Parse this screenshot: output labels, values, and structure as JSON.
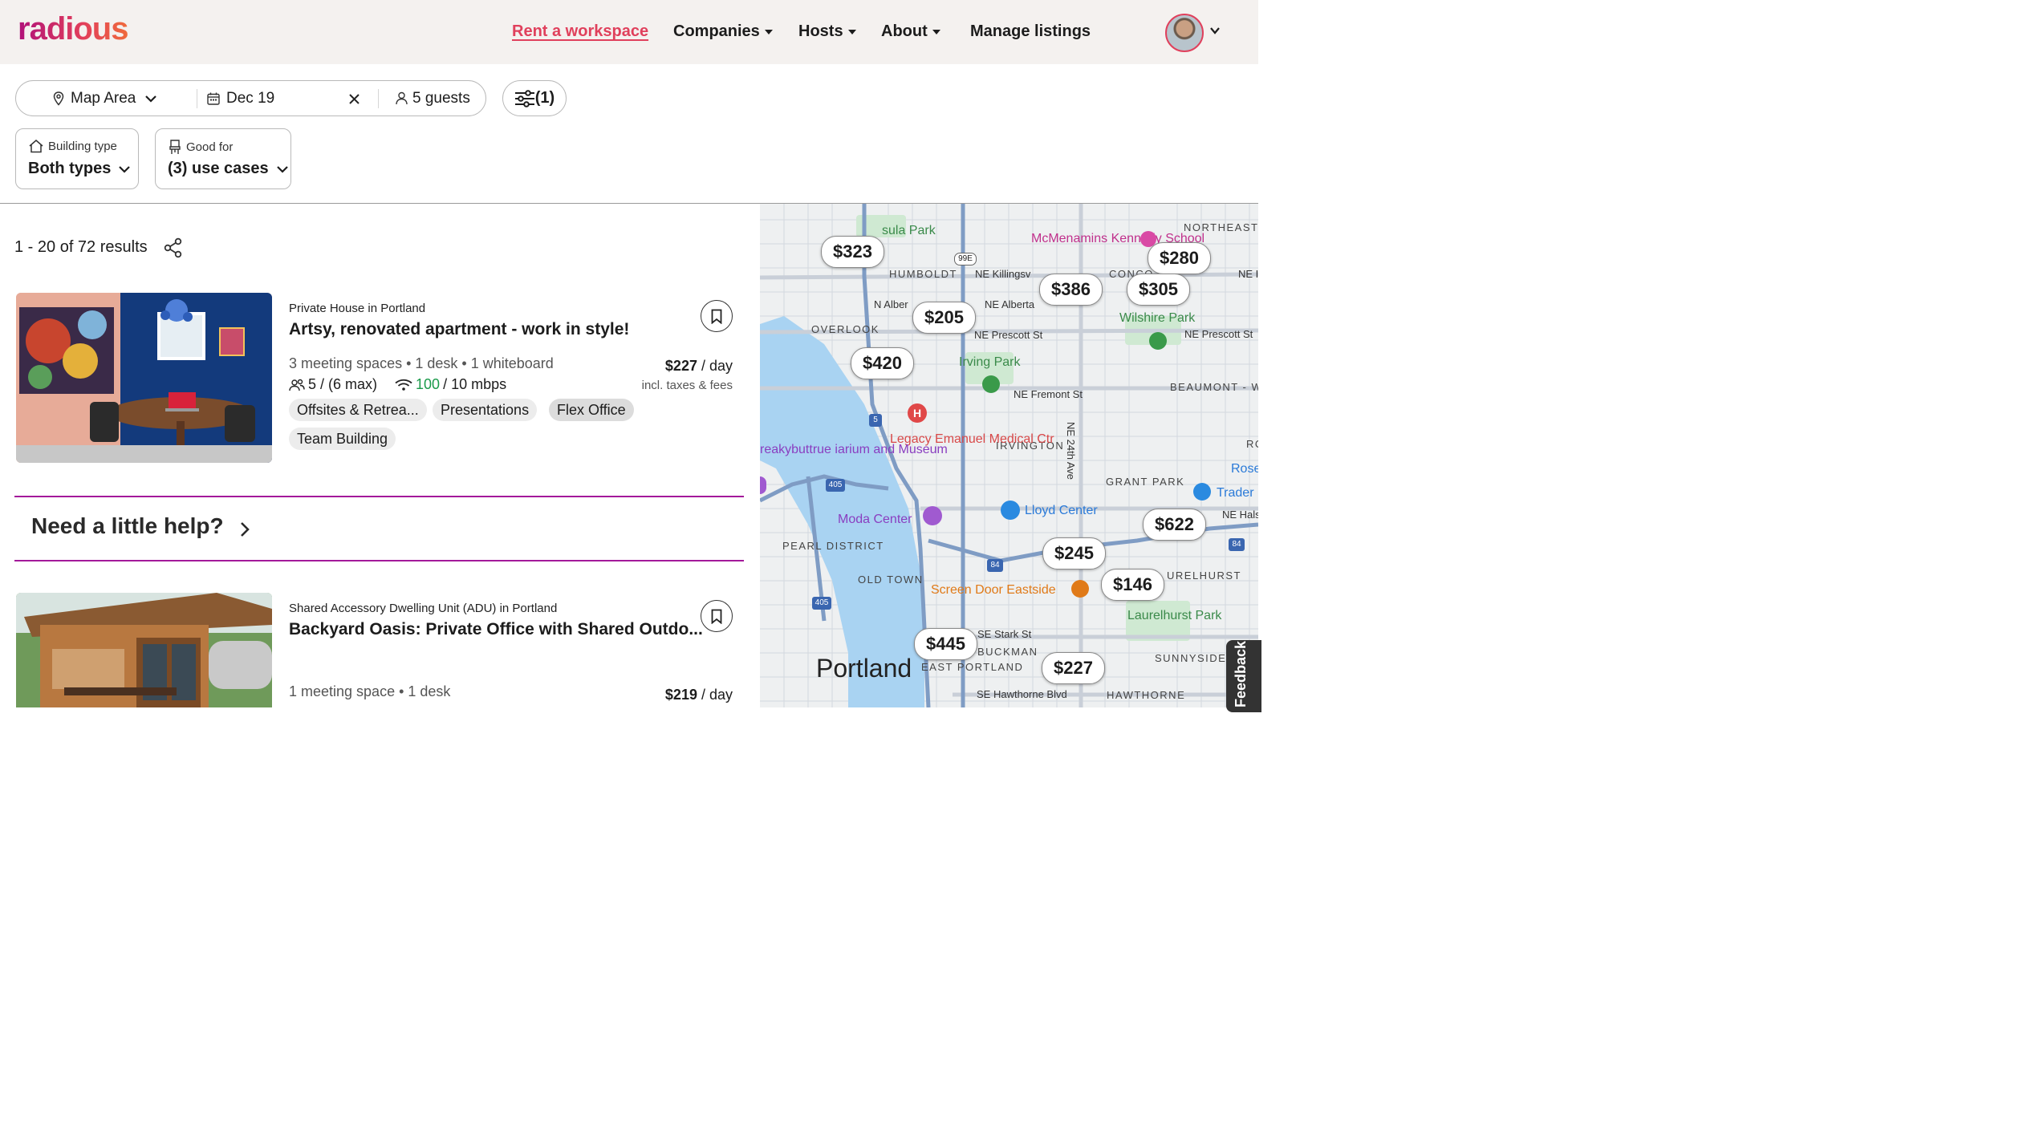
{
  "header": {
    "logo": "radious",
    "nav": [
      {
        "label": "Rent a workspace",
        "active": true,
        "dropdown": false
      },
      {
        "label": "Companies",
        "dropdown": true
      },
      {
        "label": "Hosts",
        "dropdown": true
      },
      {
        "label": "About",
        "dropdown": true
      },
      {
        "label": "Manage listings",
        "dropdown": false
      }
    ]
  },
  "search": {
    "location": "Map Area",
    "date": "Dec 19",
    "guests": "5 guests",
    "filters": "(1)"
  },
  "filters": {
    "building": {
      "label": "Building type",
      "value": "Both types"
    },
    "good_for": {
      "label": "Good for",
      "value": "(3) use cases"
    }
  },
  "results": {
    "count": "1 - 20 of 72 results",
    "listings": [
      {
        "kicker": "Private House in Portland",
        "title": "Artsy, renovated apartment - work in style!",
        "meta": "3 meeting spaces • 1 desk • 1 whiteboard",
        "capacity": "5 / (6 max)",
        "speed_down": "100",
        "speed_up": "/ 10 mbps",
        "price": "$227",
        "per": " / day",
        "fees": "incl. taxes & fees",
        "tags": [
          "Offsites & Retrea...",
          "Presentations",
          "Flex Office",
          "Team Building"
        ]
      },
      {
        "kicker": "Shared Accessory Dwelling Unit (ADU) in Portland",
        "title": "Backyard Oasis: Private Office with Shared Outdo...",
        "meta": "1 meeting space • 1 desk",
        "price": "$219",
        "per": " / day"
      }
    ]
  },
  "help": {
    "label": "Need a little help?"
  },
  "map": {
    "pins": [
      "$323",
      "$280",
      "$386",
      "$305",
      "$205",
      "$420",
      "$622",
      "$245",
      "$146",
      "$445",
      "$227"
    ],
    "places": {
      "peninsula_park": "sula Park",
      "mcmenamins": "McMenamins Kennedy School",
      "wilshire": "Wilshire Park",
      "irving": "Irving Park",
      "legacy": "Legacy Emanuel Medical Ctr",
      "conservatory": "reakybuttrue iarium and Museum",
      "moda": "Moda Center",
      "lloyd": "Lloyd Center",
      "trader": "Trader",
      "screen_door": "Screen Door Eastside",
      "laurelhurst": "Laurelhurst Park",
      "rose": "Rose",
      "portland": "Portland"
    },
    "neighborhoods": {
      "humboldt": "HUMBOLDT",
      "overlook": "OVERLOOK",
      "northeast_portland": "NORTHEAST PORTLAND",
      "concordia": "CONCO",
      "beaumont": "BEAUMONT - WILSHIRE",
      "irvington": "IRVINGTON",
      "grant_park": "GRANT PARK",
      "pearl": "PEARL DISTRICT",
      "old_town": "OLD TOWN",
      "laurelhurst_n": "URELHURST",
      "buckman": "BUCKMAN",
      "east_portland": "EAST PORTLAND",
      "sunnyside": "SUNNYSIDE",
      "hawthorne": "HAWTHORNE",
      "ro": "RO"
    },
    "streets": {
      "killingsworth": "NE Killingsv",
      "alberta": "NE Alberta",
      "prescott": "NE Prescott St",
      "prescott2": "NE Prescott St",
      "fremont": "NE Fremont St",
      "ave24": "NE 24th Ave",
      "n_alber": "N Alber",
      "stark": "SE Stark St",
      "hawthorne_blvd": "SE Hawthorne Blvd",
      "ne_hal": "NE Hals",
      "ne_right": "NE I"
    },
    "shields": {
      "i5": "5",
      "i405": "405",
      "i405b": "405",
      "i84": "84",
      "i84b": "84",
      "r99e": "99E"
    },
    "colors": {
      "water": "#a9d3f2",
      "park": "#cfe9d2",
      "road": "#c9cfd8",
      "highway": "#7f9cc4"
    }
  },
  "feedback": "Feedback",
  "colors": {
    "brand": "#e0405c",
    "accent": "#a3199a",
    "green": "#1a9a4a"
  }
}
